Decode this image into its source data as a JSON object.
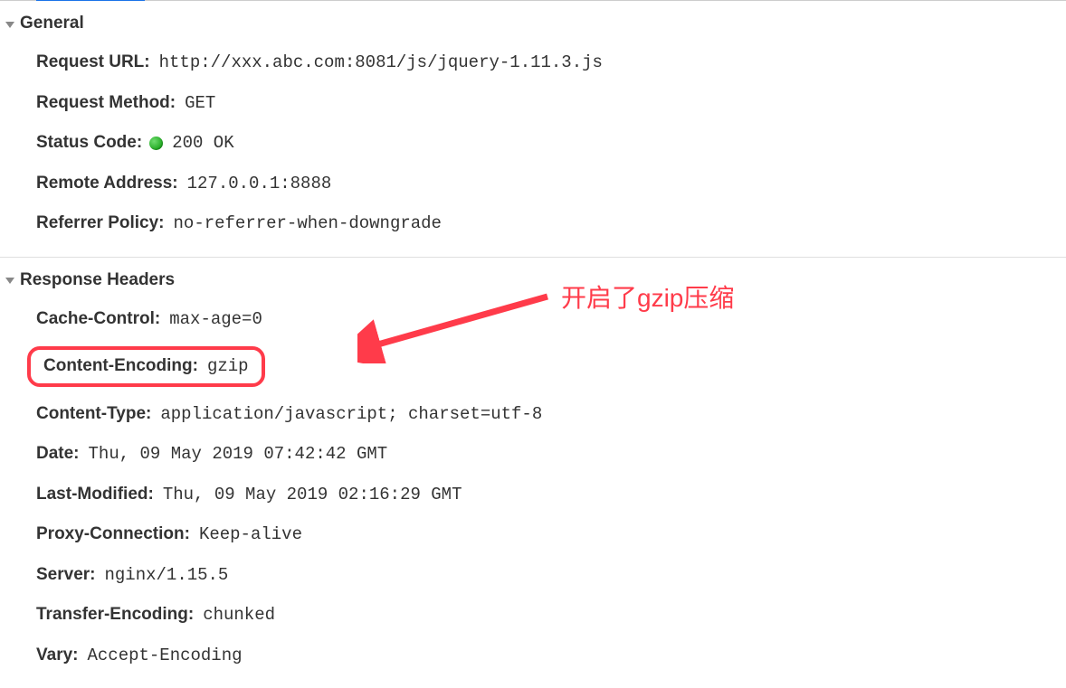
{
  "sections": {
    "general": {
      "title": "General",
      "request_url_label": "Request URL:",
      "request_url_value": "http://xxx.abc.com:8081/js/jquery-1.11.3.js",
      "request_method_label": "Request Method:",
      "request_method_value": "GET",
      "status_code_label": "Status Code:",
      "status_code_value": "200 OK",
      "remote_address_label": "Remote Address:",
      "remote_address_value": "127.0.0.1:8888",
      "referrer_policy_label": "Referrer Policy:",
      "referrer_policy_value": "no-referrer-when-downgrade"
    },
    "response": {
      "title": "Response Headers",
      "cache_control_label": "Cache-Control:",
      "cache_control_value": "max-age=0",
      "content_encoding_label": "Content-Encoding:",
      "content_encoding_value": "gzip",
      "content_type_label": "Content-Type:",
      "content_type_value": "application/javascript; charset=utf-8",
      "date_label": "Date:",
      "date_value": "Thu, 09 May 2019 07:42:42 GMT",
      "last_modified_label": "Last-Modified:",
      "last_modified_value": "Thu, 09 May 2019 02:16:29 GMT",
      "proxy_connection_label": "Proxy-Connection:",
      "proxy_connection_value": "Keep-alive",
      "server_label": "Server:",
      "server_value": "nginx/1.15.5",
      "transfer_encoding_label": "Transfer-Encoding:",
      "transfer_encoding_value": "chunked",
      "vary_label": "Vary:",
      "vary_value": "Accept-Encoding"
    }
  },
  "annotation": {
    "text": "开启了gzip压缩"
  }
}
